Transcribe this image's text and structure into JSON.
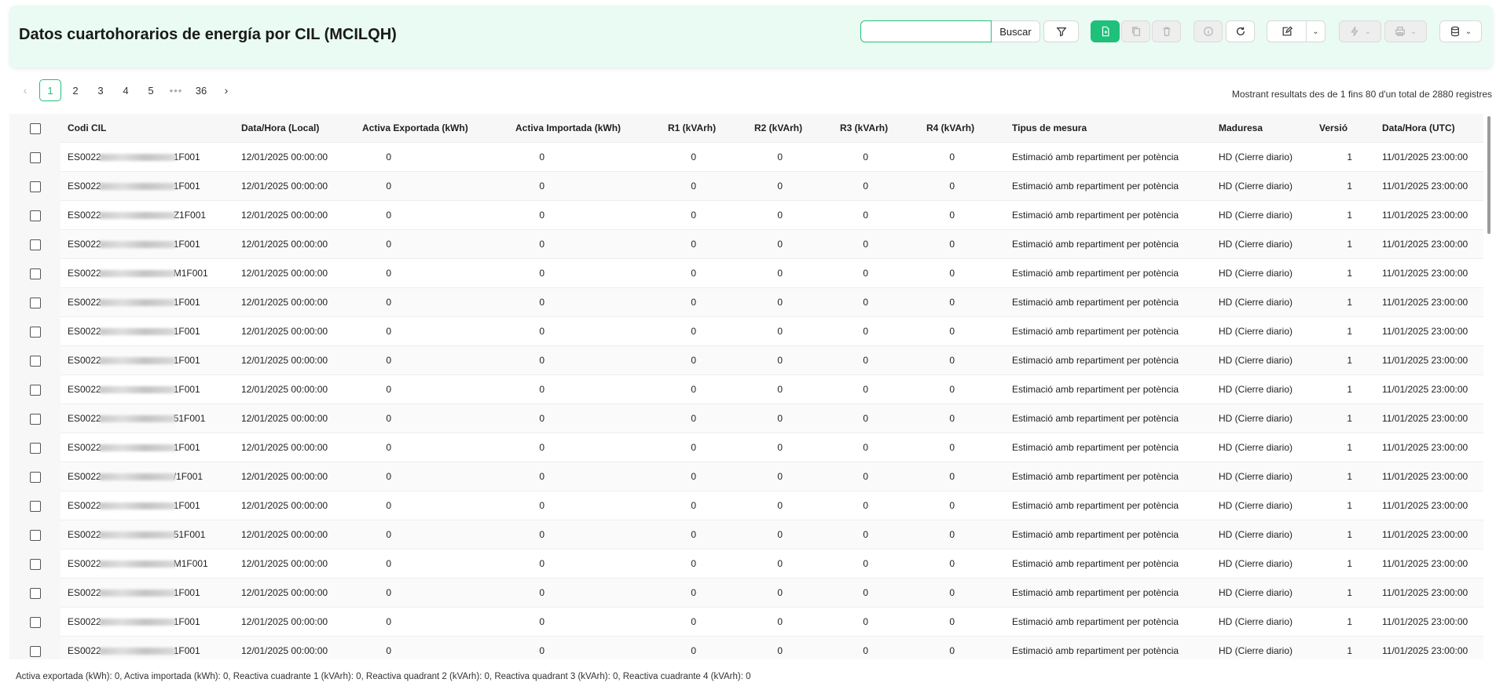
{
  "header": {
    "title": "Datos cuartohorarios de energía por CIL (MCILQH)",
    "search_value": "",
    "search_label": "Buscar",
    "icons": [
      "filter-icon",
      "new-file-icon",
      "copy-icon",
      "delete-icon",
      "info-icon",
      "refresh-icon",
      "edit-icon",
      "chevron-down-icon",
      "bolt-icon",
      "print-icon",
      "database-icon"
    ],
    "accent": "#1ec07a",
    "background": "#e9fbf2"
  },
  "pagination": {
    "pages": [
      "1",
      "2",
      "3",
      "4",
      "5",
      "36"
    ],
    "dots": "•••",
    "current": "1",
    "info": "Mostrant resultats des de 1 fins 80 d'un total de 2880 registres"
  },
  "table": {
    "columns": [
      "Codi CIL",
      "Data/Hora (Local)",
      "Activa Exportada (kWh)",
      "Activa Importada (kWh)",
      "R1 (kVArh)",
      "R2 (kVArh)",
      "R3 (kVArh)",
      "R4 (kVArh)",
      "Tipus de mesura",
      "Maduresa",
      "Versió",
      "Data/Hora (UTC)"
    ],
    "rows": [
      {
        "cil_prefix": "ES0022",
        "cil_suffix": "1F001",
        "local": "12/01/2025 00:00:00",
        "exp": "0",
        "imp": "0",
        "r1": "0",
        "r2": "0",
        "r3": "0",
        "r4": "0",
        "tipus": "Estimació amb repartiment per potència",
        "maduresa": "HD (Cierre diario)",
        "versio": "1",
        "utc": "11/01/2025 23:00:00"
      },
      {
        "cil_prefix": "ES0022",
        "cil_suffix": "1F001",
        "local": "12/01/2025 00:00:00",
        "exp": "0",
        "imp": "0",
        "r1": "0",
        "r2": "0",
        "r3": "0",
        "r4": "0",
        "tipus": "Estimació amb repartiment per potència",
        "maduresa": "HD (Cierre diario)",
        "versio": "1",
        "utc": "11/01/2025 23:00:00"
      },
      {
        "cil_prefix": "ES0022",
        "cil_suffix": "Z1F001",
        "local": "12/01/2025 00:00:00",
        "exp": "0",
        "imp": "0",
        "r1": "0",
        "r2": "0",
        "r3": "0",
        "r4": "0",
        "tipus": "Estimació amb repartiment per potència",
        "maduresa": "HD (Cierre diario)",
        "versio": "1",
        "utc": "11/01/2025 23:00:00"
      },
      {
        "cil_prefix": "ES0022",
        "cil_suffix": "1F001",
        "local": "12/01/2025 00:00:00",
        "exp": "0",
        "imp": "0",
        "r1": "0",
        "r2": "0",
        "r3": "0",
        "r4": "0",
        "tipus": "Estimació amb repartiment per potència",
        "maduresa": "HD (Cierre diario)",
        "versio": "1",
        "utc": "11/01/2025 23:00:00"
      },
      {
        "cil_prefix": "ES0022",
        "cil_suffix": "M1F001",
        "local": "12/01/2025 00:00:00",
        "exp": "0",
        "imp": "0",
        "r1": "0",
        "r2": "0",
        "r3": "0",
        "r4": "0",
        "tipus": "Estimació amb repartiment per potència",
        "maduresa": "HD (Cierre diario)",
        "versio": "1",
        "utc": "11/01/2025 23:00:00"
      },
      {
        "cil_prefix": "ES0022",
        "cil_suffix": "1F001",
        "local": "12/01/2025 00:00:00",
        "exp": "0",
        "imp": "0",
        "r1": "0",
        "r2": "0",
        "r3": "0",
        "r4": "0",
        "tipus": "Estimació amb repartiment per potència",
        "maduresa": "HD (Cierre diario)",
        "versio": "1",
        "utc": "11/01/2025 23:00:00"
      },
      {
        "cil_prefix": "ES0022",
        "cil_suffix": "1F001",
        "local": "12/01/2025 00:00:00",
        "exp": "0",
        "imp": "0",
        "r1": "0",
        "r2": "0",
        "r3": "0",
        "r4": "0",
        "tipus": "Estimació amb repartiment per potència",
        "maduresa": "HD (Cierre diario)",
        "versio": "1",
        "utc": "11/01/2025 23:00:00"
      },
      {
        "cil_prefix": "ES0022",
        "cil_suffix": "1F001",
        "local": "12/01/2025 00:00:00",
        "exp": "0",
        "imp": "0",
        "r1": "0",
        "r2": "0",
        "r3": "0",
        "r4": "0",
        "tipus": "Estimació amb repartiment per potència",
        "maduresa": "HD (Cierre diario)",
        "versio": "1",
        "utc": "11/01/2025 23:00:00"
      },
      {
        "cil_prefix": "ES0022",
        "cil_suffix": "1F001",
        "local": "12/01/2025 00:00:00",
        "exp": "0",
        "imp": "0",
        "r1": "0",
        "r2": "0",
        "r3": "0",
        "r4": "0",
        "tipus": "Estimació amb repartiment per potència",
        "maduresa": "HD (Cierre diario)",
        "versio": "1",
        "utc": "11/01/2025 23:00:00"
      },
      {
        "cil_prefix": "ES0022",
        "cil_suffix": "51F001",
        "local": "12/01/2025 00:00:00",
        "exp": "0",
        "imp": "0",
        "r1": "0",
        "r2": "0",
        "r3": "0",
        "r4": "0",
        "tipus": "Estimació amb repartiment per potència",
        "maduresa": "HD (Cierre diario)",
        "versio": "1",
        "utc": "11/01/2025 23:00:00"
      },
      {
        "cil_prefix": "ES0022",
        "cil_suffix": "1F001",
        "local": "12/01/2025 00:00:00",
        "exp": "0",
        "imp": "0",
        "r1": "0",
        "r2": "0",
        "r3": "0",
        "r4": "0",
        "tipus": "Estimació amb repartiment per potència",
        "maduresa": "HD (Cierre diario)",
        "versio": "1",
        "utc": "11/01/2025 23:00:00"
      },
      {
        "cil_prefix": "ES0022",
        "cil_suffix": "/1F001",
        "local": "12/01/2025 00:00:00",
        "exp": "0",
        "imp": "0",
        "r1": "0",
        "r2": "0",
        "r3": "0",
        "r4": "0",
        "tipus": "Estimació amb repartiment per potència",
        "maduresa": "HD (Cierre diario)",
        "versio": "1",
        "utc": "11/01/2025 23:00:00"
      },
      {
        "cil_prefix": "ES0022",
        "cil_suffix": "1F001",
        "local": "12/01/2025 00:00:00",
        "exp": "0",
        "imp": "0",
        "r1": "0",
        "r2": "0",
        "r3": "0",
        "r4": "0",
        "tipus": "Estimació amb repartiment per potència",
        "maduresa": "HD (Cierre diario)",
        "versio": "1",
        "utc": "11/01/2025 23:00:00"
      },
      {
        "cil_prefix": "ES0022",
        "cil_suffix": "51F001",
        "local": "12/01/2025 00:00:00",
        "exp": "0",
        "imp": "0",
        "r1": "0",
        "r2": "0",
        "r3": "0",
        "r4": "0",
        "tipus": "Estimació amb repartiment per potència",
        "maduresa": "HD (Cierre diario)",
        "versio": "1",
        "utc": "11/01/2025 23:00:00"
      },
      {
        "cil_prefix": "ES0022",
        "cil_suffix": "M1F001",
        "local": "12/01/2025 00:00:00",
        "exp": "0",
        "imp": "0",
        "r1": "0",
        "r2": "0",
        "r3": "0",
        "r4": "0",
        "tipus": "Estimació amb repartiment per potència",
        "maduresa": "HD (Cierre diario)",
        "versio": "1",
        "utc": "11/01/2025 23:00:00"
      },
      {
        "cil_prefix": "ES0022",
        "cil_suffix": "1F001",
        "local": "12/01/2025 00:00:00",
        "exp": "0",
        "imp": "0",
        "r1": "0",
        "r2": "0",
        "r3": "0",
        "r4": "0",
        "tipus": "Estimació amb repartiment per potència",
        "maduresa": "HD (Cierre diario)",
        "versio": "1",
        "utc": "11/01/2025 23:00:00"
      },
      {
        "cil_prefix": "ES0022",
        "cil_suffix": "1F001",
        "local": "12/01/2025 00:00:00",
        "exp": "0",
        "imp": "0",
        "r1": "0",
        "r2": "0",
        "r3": "0",
        "r4": "0",
        "tipus": "Estimació amb repartiment per potència",
        "maduresa": "HD (Cierre diario)",
        "versio": "1",
        "utc": "11/01/2025 23:00:00"
      },
      {
        "cil_prefix": "ES0022",
        "cil_suffix": "1F001",
        "local": "12/01/2025 00:00:00",
        "exp": "0",
        "imp": "0",
        "r1": "0",
        "r2": "0",
        "r3": "0",
        "r4": "0",
        "tipus": "Estimació amb repartiment per potència",
        "maduresa": "HD (Cierre diario)",
        "versio": "1",
        "utc": "11/01/2025 23:00:00"
      }
    ]
  },
  "footer": {
    "summary": "Activa exportada (kWh): 0, Activa importada (kWh): 0, Reactiva cuadrante 1 (kVArh): 0, Reactiva quadrant 2 (kVArh): 0, Reactiva quadrant 3 (kVArh): 0, Reactiva cuadrante 4 (kVArh): 0"
  }
}
